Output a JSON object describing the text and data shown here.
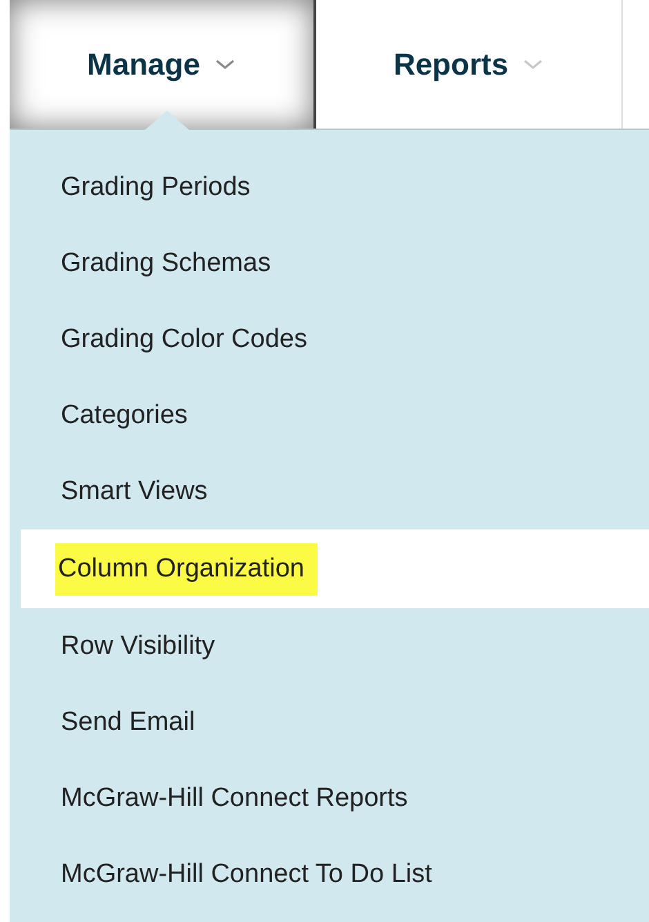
{
  "tabs": [
    {
      "label": "Manage",
      "selected": true
    },
    {
      "label": "Reports",
      "selected": false
    }
  ],
  "menu": {
    "items": [
      {
        "label": "Grading Periods",
        "selected": false
      },
      {
        "label": "Grading Schemas",
        "selected": false
      },
      {
        "label": "Grading Color Codes",
        "selected": false
      },
      {
        "label": "Categories",
        "selected": false
      },
      {
        "label": "Smart Views",
        "selected": false
      },
      {
        "label": "Column Organization",
        "selected": true
      },
      {
        "label": "Row Visibility",
        "selected": false
      },
      {
        "label": "Send Email",
        "selected": false
      },
      {
        "label": "McGraw-Hill Connect Reports",
        "selected": false
      },
      {
        "label": "McGraw-Hill Connect To Do List",
        "selected": false
      }
    ]
  }
}
